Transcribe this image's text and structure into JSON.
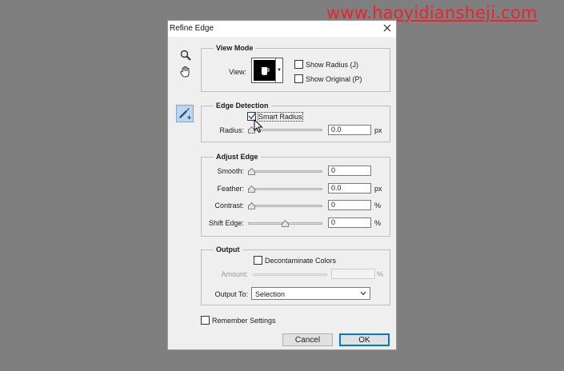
{
  "watermark": "www.haoyidiansheji.com",
  "dialog": {
    "title": "Refine Edge",
    "view_mode": {
      "heading": "View Mode",
      "view_label": "View:",
      "show_radius": {
        "label": "Show Radius (J)",
        "checked": false
      },
      "show_original": {
        "label": "Show Original (P)",
        "checked": false
      }
    },
    "edge_detection": {
      "heading": "Edge Detection",
      "smart_radius": {
        "label": "Smart Radius",
        "checked": true
      },
      "radius": {
        "label": "Radius:",
        "value": "0.0",
        "unit": "px"
      }
    },
    "adjust_edge": {
      "heading": "Adjust Edge",
      "smooth": {
        "label": "Smooth:",
        "value": "0",
        "unit": ""
      },
      "feather": {
        "label": "Feather:",
        "value": "0.0",
        "unit": "px"
      },
      "contrast": {
        "label": "Contrast:",
        "value": "0",
        "unit": "%"
      },
      "shift_edge": {
        "label": "Shift Edge:",
        "value": "0",
        "unit": "%"
      }
    },
    "output": {
      "heading": "Output",
      "decontaminate": {
        "label": "Decontaminate Colors",
        "checked": false
      },
      "amount": {
        "label": "Amount:",
        "value": "",
        "unit": "%"
      },
      "output_to": {
        "label": "Output To:",
        "selected": "Selection"
      }
    },
    "remember_settings": {
      "label": "Remember Settings",
      "checked": false
    },
    "cancel_label": "Cancel",
    "ok_label": "OK"
  },
  "colors": {
    "watermark": "#e8242c",
    "dialog_bg": "#efefef",
    "default_button_border": "#0078d7"
  },
  "icons": [
    "zoom-tool-icon",
    "hand-tool-icon",
    "refine-radius-brush-icon",
    "close-icon",
    "dropdown-arrow-icon"
  ]
}
